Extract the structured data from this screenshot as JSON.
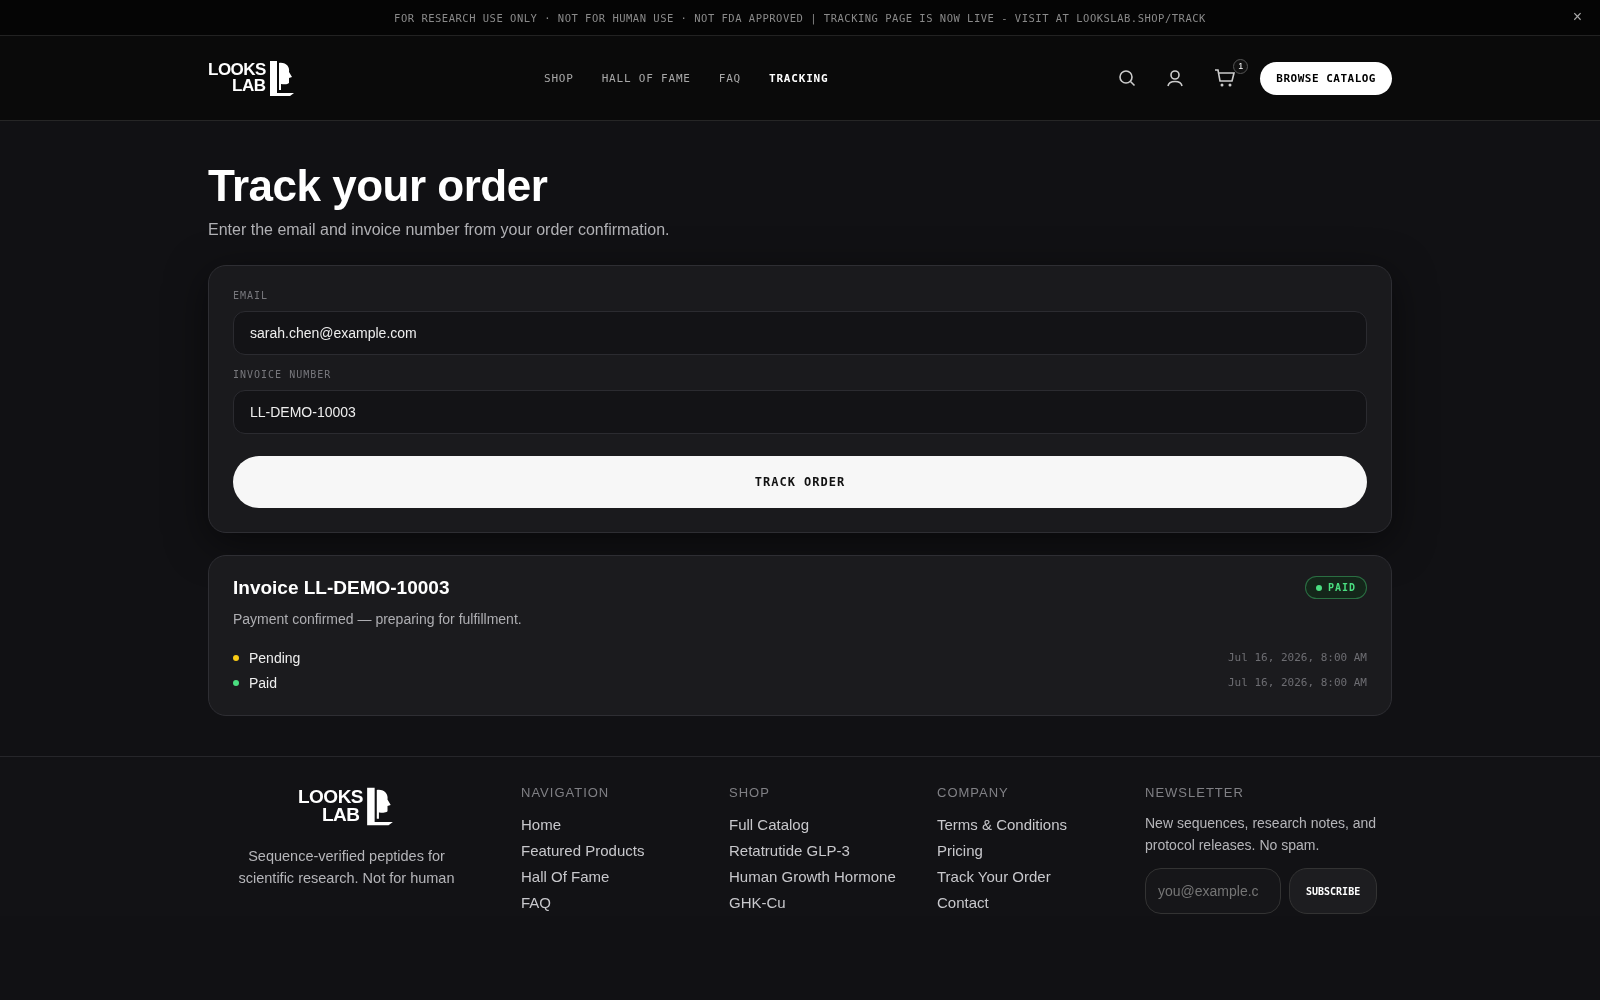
{
  "announcement": {
    "text": "FOR RESEARCH USE ONLY · NOT FOR HUMAN USE · NOT FDA APPROVED | TRACKING PAGE IS NOW LIVE - VISIT AT LOOKSLAB.SHOP/TRACK",
    "close": "×"
  },
  "header": {
    "logo": [
      "LOOKS",
      "LAB"
    ],
    "nav": [
      {
        "label": "SHOP",
        "selected": false
      },
      {
        "label": "HALL OF FAME",
        "selected": false
      },
      {
        "label": "FAQ",
        "selected": false
      },
      {
        "label": "TRACKING",
        "selected": true
      }
    ],
    "cart_count": "1",
    "cta": "BROWSE CATALOG"
  },
  "page": {
    "title": "Track your order",
    "subtitle": "Enter the email and invoice number from your order confirmation."
  },
  "form": {
    "fields": [
      {
        "label": "EMAIL",
        "value": "sarah.chen@example.com"
      },
      {
        "label": "INVOICE NUMBER",
        "value": "LL-DEMO-10003"
      }
    ],
    "submit": "TRACK ORDER"
  },
  "result": {
    "title": "Invoice LL-DEMO-10003",
    "status": "PAID",
    "color": "#4ade80",
    "message": "Payment confirmed — preparing for fulfillment.",
    "events": [
      {
        "label": "Pending",
        "time": "Jul 16, 2026, 8:00 AM",
        "color": "#facc15"
      },
      {
        "label": "Paid",
        "time": "Jul 16, 2026, 8:00 AM",
        "color": "#4ade80"
      }
    ]
  },
  "footer": {
    "logo": [
      "LOOKS",
      "LAB"
    ],
    "tagline": "Sequence-verified peptides for scientific research. Not for human",
    "columns": [
      {
        "heading": "NAVIGATION",
        "links": [
          "Home",
          "Featured Products",
          "Hall Of Fame",
          "FAQ"
        ]
      },
      {
        "heading": "SHOP",
        "links": [
          "Full Catalog",
          "Retatrutide GLP-3",
          "Human Growth Hormone",
          "GHK-Cu"
        ]
      },
      {
        "heading": "COMPANY",
        "links": [
          "Terms & Conditions",
          "Pricing",
          "Track Your Order",
          "Contact"
        ]
      }
    ],
    "newsletter": {
      "heading": "NEWSLETTER",
      "text": "New sequences, research notes, and protocol releases. No spam.",
      "placeholder": "you@example.c",
      "button": "SUBSCRIBE"
    }
  }
}
